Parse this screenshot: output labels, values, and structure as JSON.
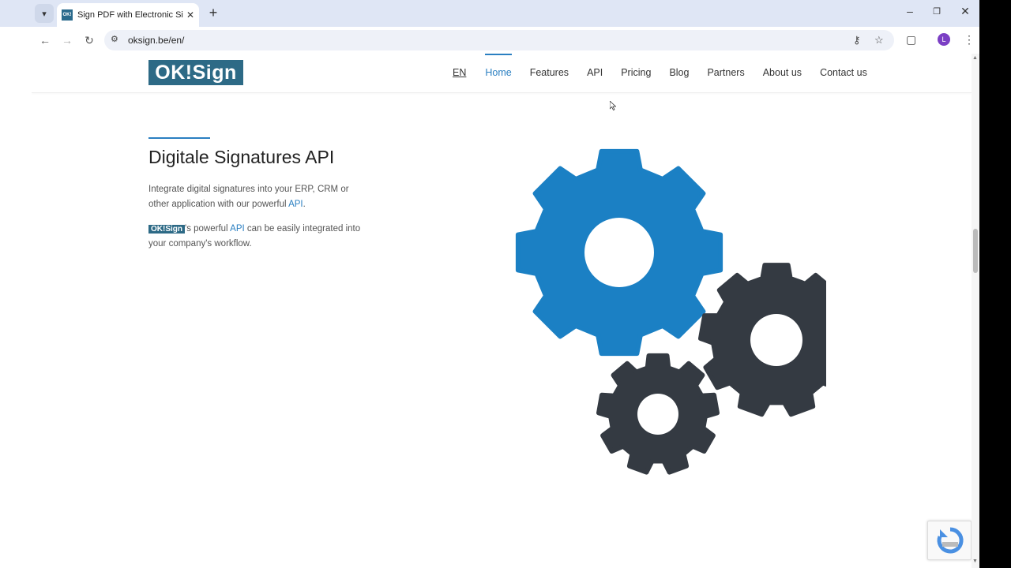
{
  "browser": {
    "tab_title": "Sign PDF with Electronic Signatu",
    "favicon_text": "OK!",
    "url": "oksign.be/en/",
    "profile_initial": "L"
  },
  "site": {
    "logo": "OK!Sign",
    "nav": [
      "EN",
      "Home",
      "Features",
      "API",
      "Pricing",
      "Blog",
      "Partners",
      "About us",
      "Contact us"
    ],
    "active_nav": "Home",
    "accent_color": "#2a7fc1",
    "brand_color": "#2d6a86"
  },
  "content": {
    "heading": "Digitale Signatures API",
    "para1_text": "Integrate digital signatures into your ERP, CRM or other application with our powerful ",
    "para1_link": "API",
    "para1_end": ".",
    "para2_brand": "OK!Sign",
    "para2_text1": "'s powerful ",
    "para2_link": "API",
    "para2_text2": " can be easily integrated into your company's workflow."
  },
  "illustration": {
    "gear_colors": [
      "#1b80c4",
      "#343a42"
    ]
  }
}
